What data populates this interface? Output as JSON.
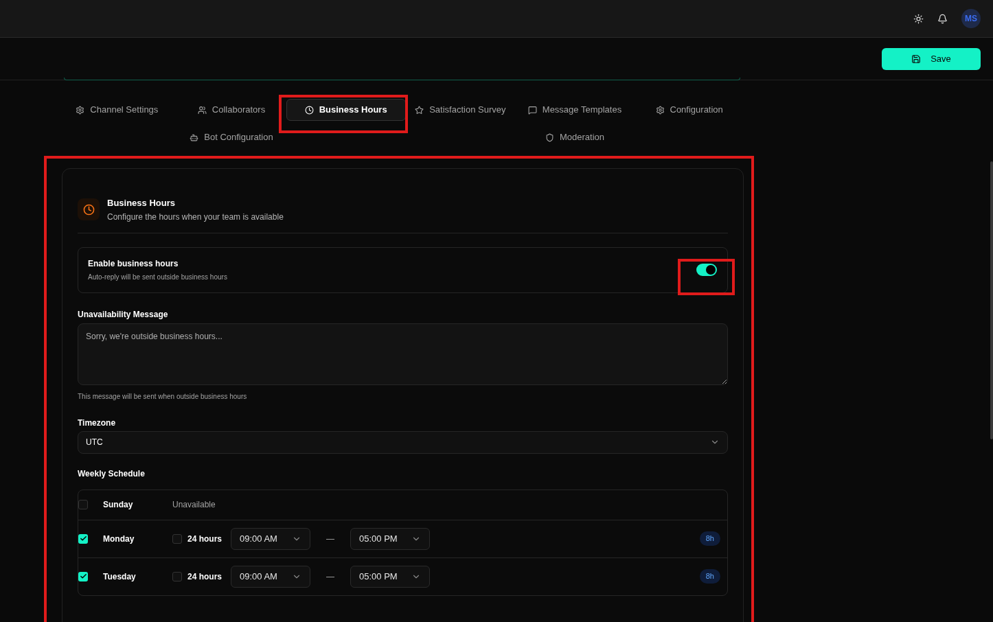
{
  "topbar": {
    "avatar": "MS"
  },
  "save_button": "Save",
  "tabs": [
    {
      "label": "Channel Settings",
      "selected": false
    },
    {
      "label": "Collaborators",
      "selected": false
    },
    {
      "label": "Business Hours",
      "selected": true
    },
    {
      "label": "Satisfaction Survey",
      "selected": false
    },
    {
      "label": "Message Templates",
      "selected": false
    },
    {
      "label": "Configuration",
      "selected": false
    },
    {
      "label": "Bot Configuration",
      "selected": false
    },
    {
      "label": "Moderation",
      "selected": false
    }
  ],
  "section": {
    "title": "Business Hours",
    "subtitle": "Configure the hours when your team is available"
  },
  "enable": {
    "title": "Enable business hours",
    "description": "Auto-reply will be sent outside business hours",
    "on": true
  },
  "unavailability": {
    "label": "Unavailability Message",
    "placeholder": "Sorry, we're outside business hours...",
    "helper": "This message will be sent when outside business hours"
  },
  "timezone": {
    "label": "Timezone",
    "value": "UTC"
  },
  "schedule": {
    "title": "Weekly Schedule",
    "days": [
      {
        "name": "Sunday",
        "enabled": false,
        "status": "Unavailable"
      },
      {
        "name": "Monday",
        "enabled": true,
        "all_day": false,
        "all_day_label": "24 hours",
        "start": "09:00 AM",
        "separator": "—",
        "end": "05:00 PM",
        "duration": "8h"
      },
      {
        "name": "Tuesday",
        "enabled": true,
        "all_day": false,
        "all_day_label": "24 hours",
        "start": "09:00 AM",
        "separator": "—",
        "end": "05:00 PM",
        "duration": "8h"
      }
    ]
  }
}
